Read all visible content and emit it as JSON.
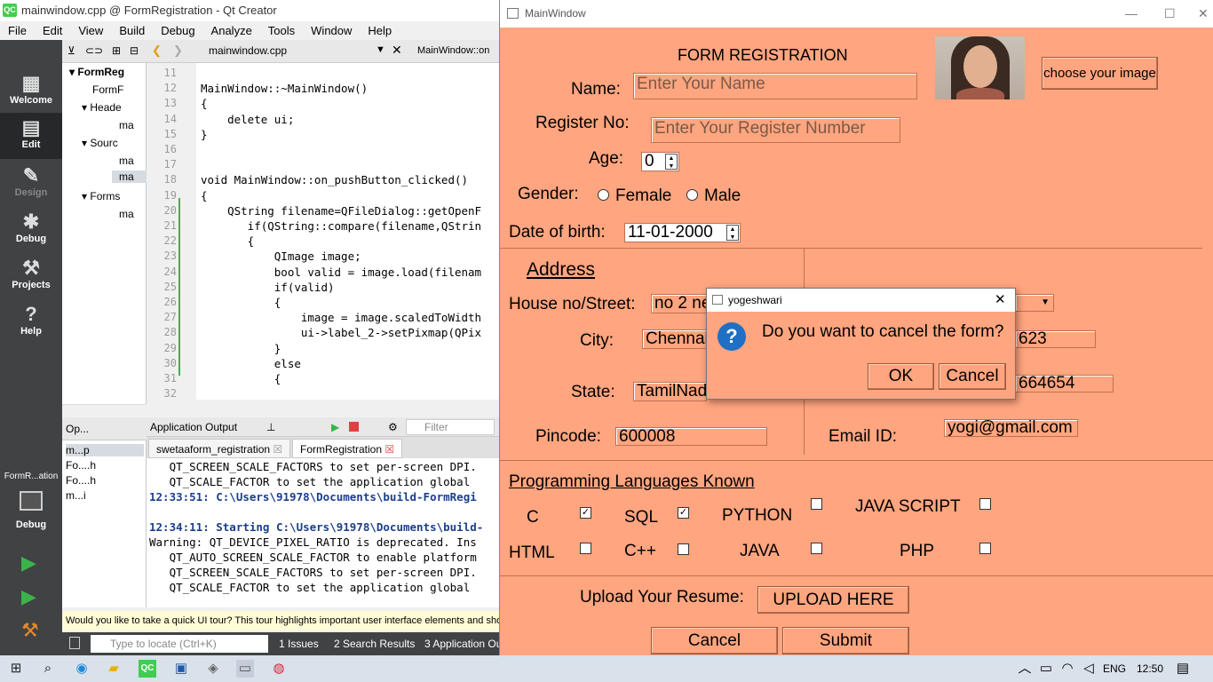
{
  "qt": {
    "title": "mainwindow.cpp @ FormRegistration - Qt Creator",
    "menu": [
      "File",
      "Edit",
      "View",
      "Build",
      "Debug",
      "Analyze",
      "Tools",
      "Window",
      "Help"
    ],
    "modes": [
      "Welcome",
      "Edit",
      "Design",
      "Debug",
      "Projects",
      "Help"
    ],
    "kit_label": "FormR...ation",
    "kit_mode": "Debug",
    "tree": [
      "FormReg",
      "FormF",
      "Heade",
      "ma",
      "Sourc",
      "ma",
      "ma",
      "Forms",
      "ma"
    ],
    "editor_tabs": [
      "mainwindow.cpp",
      "MainWindow::on"
    ],
    "line_numbers": [
      "11",
      "12",
      "13",
      "14",
      "15",
      "16",
      "17",
      "18",
      "19",
      "20",
      "21",
      "22",
      "23",
      "24",
      "25",
      "26",
      "27",
      "28",
      "29",
      "30",
      "31",
      "32"
    ],
    "code": [
      "",
      "MainWindow::~MainWindow()",
      "{",
      "    delete ui;",
      "}",
      "",
      "",
      "void MainWindow::on_pushButton_clicked()",
      "{",
      "    QString filename=QFileDialog::getOpenF",
      "       if(QString::compare(filename,QStrin",
      "       {",
      "           QImage image;",
      "           bool valid = image.load(filenam",
      "           if(valid)",
      "           {",
      "               image = image.scaledToWidth",
      "               ui->label_2->setPixmap(QPix",
      "           }",
      "           else",
      "           {",
      ""
    ],
    "output_title": "Application Output",
    "filter_placeholder": "Filter",
    "output_tabs": [
      "swetaaform_registration",
      "FormRegistration"
    ],
    "output_lines": [
      "   QT_SCREEN_SCALE_FACTORS to set per-screen DPI.",
      "   QT_SCALE_FACTOR to set the application global",
      "12:33:51: C:\\Users\\91978\\Documents\\build-FormRegi",
      "",
      "12:34:11: Starting C:\\Users\\91978\\Documents\\build-",
      "Warning: QT_DEVICE_PIXEL_RATIO is deprecated. Ins",
      "   QT_AUTO_SCREEN_SCALE_FACTOR to enable platform",
      "   QT_SCREEN_SCALE_FACTORS to set per-screen DPI.",
      "   QT_SCALE_FACTOR to set the application global"
    ],
    "open_docs_label": "Op...",
    "open_docs": [
      "m...p",
      "Fo....h",
      "Fo....h",
      "m...i"
    ],
    "tour": "Would you like to take a quick UI tour? This tour highlights important user interface elements and show",
    "locate_placeholder": "Type to locate (Ctrl+K)",
    "status_tabs": [
      "1  Issues",
      "2  Search Results",
      "3  Application Ou"
    ]
  },
  "form": {
    "window_title": "MainWindow",
    "heading": "FORM REGISTRATION",
    "choose_image": "choose your image",
    "name_label": "Name:",
    "name_placeholder": "Enter Your Name",
    "regno_label": "Register No:",
    "regno_placeholder": "Enter Your Register Number",
    "age_label": "Age:",
    "age_value": "0",
    "gender_label": "Gender:",
    "female": "Female",
    "male": "Male",
    "dob_label": "Date of  birth:",
    "dob_value": "11-01-2000",
    "address_heading": "Address",
    "house_label": "House no/Street:",
    "house_value": "no 2 ne",
    "city_label": "City:",
    "city_value": "Chennai",
    "state_label": "State:",
    "state_value": "TamilNad",
    "pincode_label": "Pincode:",
    "pincode_value": "600008",
    "phone1_partial": "623",
    "phone2_partial": "664654",
    "email_label": "Email ID:",
    "email_value": "yogi@gmail.com",
    "lang_heading": "Programming  Languages Known",
    "languages": [
      {
        "name": "C",
        "checked": true
      },
      {
        "name": "SQL",
        "checked": true
      },
      {
        "name": "PYTHON",
        "checked": false
      },
      {
        "name": "JAVA SCRIPT",
        "checked": false
      },
      {
        "name": "HTML",
        "checked": false
      },
      {
        "name": "C++",
        "checked": false
      },
      {
        "name": "JAVA",
        "checked": false
      },
      {
        "name": "PHP",
        "checked": false
      }
    ],
    "resume_label": "Upload Your Resume:",
    "upload_button": "UPLOAD HERE",
    "cancel_button": "Cancel",
    "submit_button": "Submit"
  },
  "dialog": {
    "title": "yogeshwari",
    "message": "Do you want to cancel the form?",
    "ok": "OK",
    "cancel": "Cancel"
  },
  "taskbar": {
    "lang": "ENG",
    "time": "12:50"
  }
}
